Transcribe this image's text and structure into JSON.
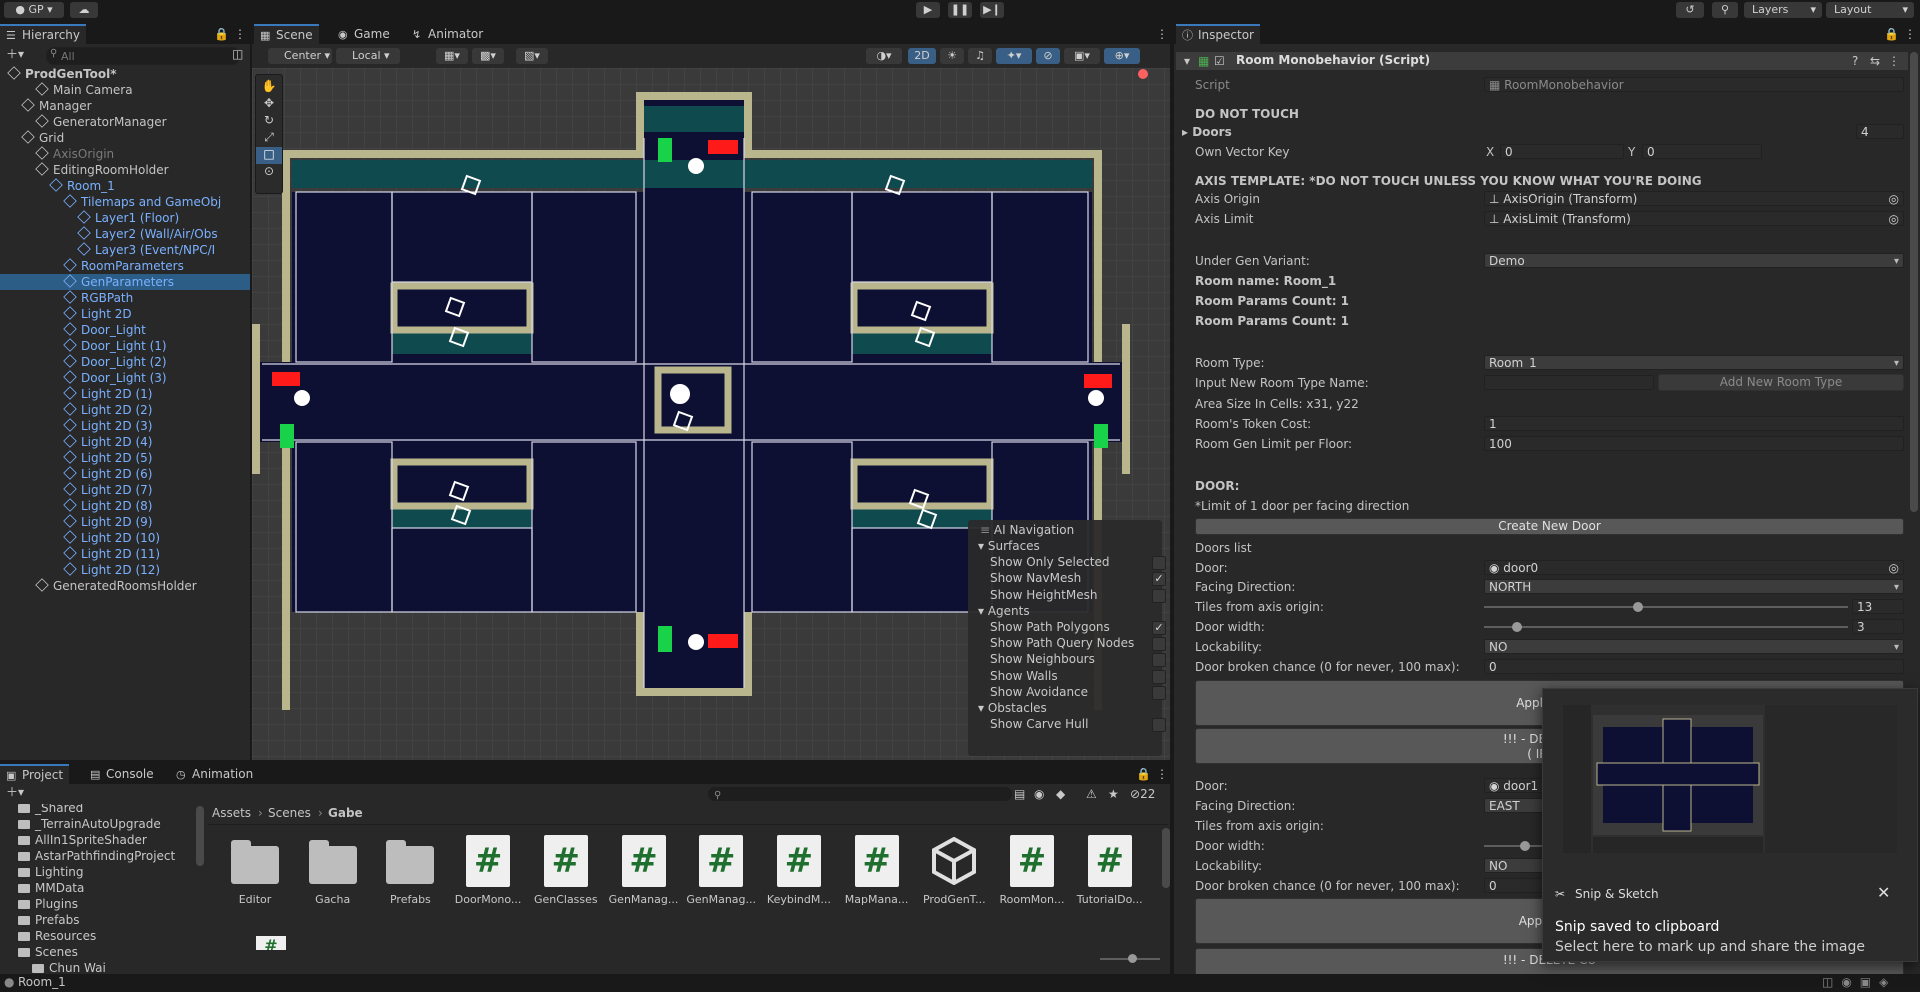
{
  "toolbar": {
    "account": "GP",
    "layers": "Layers",
    "layout": "Layout"
  },
  "hierarchy": {
    "tab": "Hierarchy",
    "search_placeholder": "All",
    "items": [
      {
        "label": "ProdGenTool*",
        "indent": 0,
        "style": "bold"
      },
      {
        "label": "Main Camera",
        "indent": 2,
        "style": ""
      },
      {
        "label": "Manager",
        "indent": 1,
        "style": ""
      },
      {
        "label": "GeneratorManager",
        "indent": 2,
        "style": ""
      },
      {
        "label": "Grid",
        "indent": 1,
        "style": ""
      },
      {
        "label": "AxisOrigin",
        "indent": 2,
        "style": "dim"
      },
      {
        "label": "EditingRoomHolder",
        "indent": 2,
        "style": ""
      },
      {
        "label": "Room_1",
        "indent": 3,
        "style": "blue"
      },
      {
        "label": "Tilemaps and GameObj",
        "indent": 4,
        "style": "blue"
      },
      {
        "label": "Layer1 (Floor)",
        "indent": 5,
        "style": "blue"
      },
      {
        "label": "Layer2 (Wall/Air/Obs",
        "indent": 5,
        "style": "blue"
      },
      {
        "label": "Layer3 (Event/NPC/I",
        "indent": 5,
        "style": "blue"
      },
      {
        "label": "RoomParameters",
        "indent": 4,
        "style": "blue"
      },
      {
        "label": "GenParameters",
        "indent": 4,
        "style": "blue"
      },
      {
        "label": "RGBPath",
        "indent": 4,
        "style": "blue"
      },
      {
        "label": "Light 2D",
        "indent": 4,
        "style": "blue"
      },
      {
        "label": "Door_Light",
        "indent": 4,
        "style": "blue"
      },
      {
        "label": "Door_Light (1)",
        "indent": 4,
        "style": "blue"
      },
      {
        "label": "Door_Light (2)",
        "indent": 4,
        "style": "blue"
      },
      {
        "label": "Door_Light (3)",
        "indent": 4,
        "style": "blue"
      },
      {
        "label": "Light 2D (1)",
        "indent": 4,
        "style": "blue"
      },
      {
        "label": "Light 2D (2)",
        "indent": 4,
        "style": "blue"
      },
      {
        "label": "Light 2D (3)",
        "indent": 4,
        "style": "blue"
      },
      {
        "label": "Light 2D (4)",
        "indent": 4,
        "style": "blue"
      },
      {
        "label": "Light 2D (5)",
        "indent": 4,
        "style": "blue"
      },
      {
        "label": "Light 2D (6)",
        "indent": 4,
        "style": "blue"
      },
      {
        "label": "Light 2D (7)",
        "indent": 4,
        "style": "blue"
      },
      {
        "label": "Light 2D (8)",
        "indent": 4,
        "style": "blue"
      },
      {
        "label": "Light 2D (9)",
        "indent": 4,
        "style": "blue"
      },
      {
        "label": "Light 2D (10)",
        "indent": 4,
        "style": "blue"
      },
      {
        "label": "Light 2D (11)",
        "indent": 4,
        "style": "blue"
      },
      {
        "label": "Light 2D (12)",
        "indent": 4,
        "style": "blue"
      },
      {
        "label": "GeneratedRoomsHolder",
        "indent": 2,
        "style": ""
      }
    ]
  },
  "scene": {
    "tabs": [
      "Scene",
      "Game",
      "Animator"
    ],
    "pivot": "Center",
    "space": "Local",
    "mode_2d": "2D"
  },
  "ai_nav": {
    "title": "AI Navigation",
    "rows": [
      {
        "label": "Surfaces",
        "type": "header"
      },
      {
        "label": "Show Only Selected",
        "type": "check",
        "checked": false
      },
      {
        "label": "Show NavMesh",
        "type": "check",
        "checked": true
      },
      {
        "label": "Show HeightMesh",
        "type": "check",
        "checked": false
      },
      {
        "label": "Agents",
        "type": "header"
      },
      {
        "label": "Show Path Polygons",
        "type": "check",
        "checked": true
      },
      {
        "label": "Show Path Query Nodes",
        "type": "check",
        "checked": false
      },
      {
        "label": "Show Neighbours",
        "type": "check",
        "checked": false
      },
      {
        "label": "Show Walls",
        "type": "check",
        "checked": false
      },
      {
        "label": "Show Avoidance",
        "type": "check",
        "checked": false
      },
      {
        "label": "Obstacles",
        "type": "header"
      },
      {
        "label": "Show Carve Hull",
        "type": "check",
        "checked": false
      }
    ]
  },
  "inspector": {
    "tab": "Inspector",
    "component": "Room Monobehavior (Script)",
    "script_label": "Script",
    "script_value": "RoomMonobehavior",
    "do_not_touch": "DO NOT TOUCH",
    "doors_label": "Doors",
    "doors_count": "4",
    "own_vector_key": "Own Vector Key",
    "x_label": "X",
    "x_value": "0",
    "y_label": "Y",
    "y_value": "0",
    "axis_template": "AXIS TEMPLATE: *DO NOT TOUCH UNLESS YOU KNOW WHAT YOU'RE DOING",
    "axis_origin_label": "Axis Origin",
    "axis_origin_value": "AxisOrigin (Transform)",
    "axis_limit_label": "Axis Limit",
    "axis_limit_value": "AxisLimit (Transform)",
    "under_gen_label": "Under Gen Variant:",
    "under_gen_value": "Demo",
    "room_name": "Room name: Room_1",
    "room_params_1": "Room Params Count: 1",
    "room_params_2": "Room Params Count: 1",
    "room_type_label": "Room Type:",
    "room_type_value": "Room_1",
    "new_type_label": "Input New Room Type Name:",
    "add_type_button": "Add New Room Type",
    "area_size": "Area Size In Cells: x31, y22",
    "token_cost_label": "Room's Token Cost:",
    "token_cost_value": "1",
    "gen_limit_label": "Room Gen Limit per Floor:",
    "gen_limit_value": "100",
    "door_header": "DOOR:",
    "door_limit": "*Limit of 1 door per facing direction",
    "create_door": "Create New Door",
    "doors_list": "Doors list",
    "door0": {
      "door_label": "Door:",
      "door_value": "door0",
      "facing_label": "Facing Direction:",
      "facing_value": "NORTH",
      "tiles_label": "Tiles from axis origin:",
      "tiles_value": "13",
      "tiles_fraction": 0.42,
      "width_label": "Door width:",
      "width_value": "3",
      "width_fraction": 0.08,
      "lock_label": "Lockability:",
      "lock_value": "NO",
      "broken_label": "Door broken chance (0 for never, 100 max):",
      "broken_value": "0",
      "apply": "Apply Door",
      "delete_1": "!!! - DELETE CU",
      "delete_2": "( IRREV"
    },
    "door1": {
      "door_label": "Door:",
      "door_value": "door1",
      "facing_label": "Facing Direction:",
      "facing_value": "EAST",
      "tiles_label": "Tiles from axis origin:",
      "width_label": "Door width:",
      "lock_label": "Lockability:",
      "lock_value": "NO",
      "broken_label": "Door broken chance (0 for never, 100 max):",
      "broken_value": "0",
      "apply": "Apply Doo",
      "delete_1": "!!! - DELETE CU"
    }
  },
  "project": {
    "tabs": [
      "Project",
      "Console",
      "Animation"
    ],
    "tree": [
      {
        "label": "_Shared",
        "indent": 1
      },
      {
        "label": "_TerrainAutoUpgrade",
        "indent": 1
      },
      {
        "label": "AllIn1SpriteShader",
        "indent": 1
      },
      {
        "label": "AstarPathfindingProject",
        "indent": 1
      },
      {
        "label": "Lighting",
        "indent": 1
      },
      {
        "label": "MMData",
        "indent": 1
      },
      {
        "label": "Plugins",
        "indent": 1
      },
      {
        "label": "Prefabs",
        "indent": 1
      },
      {
        "label": "Resources",
        "indent": 1
      },
      {
        "label": "Scenes",
        "indent": 1
      },
      {
        "label": "Chun Wai",
        "indent": 2
      }
    ],
    "breadcrumb": [
      "Assets",
      "Scenes",
      "Gabe"
    ],
    "hidden_count": "22",
    "assets": [
      {
        "label": "Editor",
        "kind": "folder"
      },
      {
        "label": "Gacha",
        "kind": "folder"
      },
      {
        "label": "Prefabs",
        "kind": "folder"
      },
      {
        "label": "DoorMono...",
        "kind": "script"
      },
      {
        "label": "GenClasses",
        "kind": "script"
      },
      {
        "label": "GenManag...",
        "kind": "script"
      },
      {
        "label": "GenManag...",
        "kind": "script"
      },
      {
        "label": "KeybindM...",
        "kind": "script"
      },
      {
        "label": "MapMana...",
        "kind": "script"
      },
      {
        "label": "ProdGenT...",
        "kind": "unity"
      },
      {
        "label": "RoomMon...",
        "kind": "script"
      },
      {
        "label": "TutorialDo...",
        "kind": "script"
      }
    ]
  },
  "status_bar": {
    "text": "Room_1"
  },
  "snip": {
    "app": "Snip & Sketch",
    "title": "Snip saved to clipboard",
    "subtitle": "Select here to mark up and share the image"
  }
}
